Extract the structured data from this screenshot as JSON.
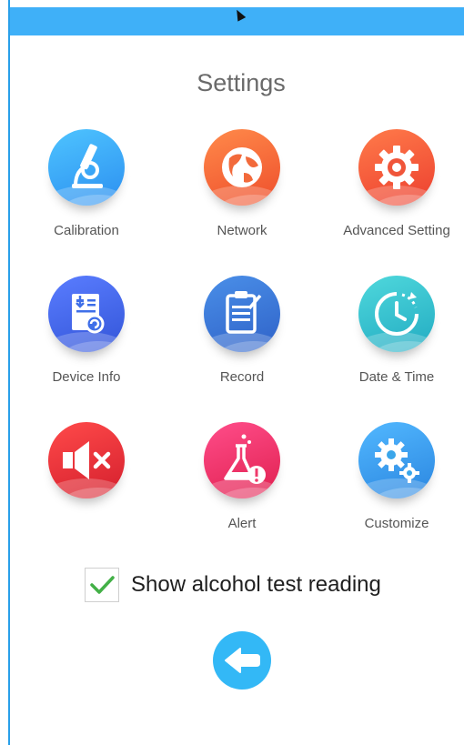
{
  "title": "Settings",
  "colors": {
    "top_bar": "#3fb0f8",
    "checkmark": "#43b047",
    "back_button": "#33b8f6"
  },
  "tiles": [
    {
      "label": "Calibration",
      "icon": "microscope-icon",
      "color": "#3aa9f1"
    },
    {
      "label": "Network",
      "icon": "globe-icon",
      "color": "#f26a3b"
    },
    {
      "label": "Advanced Setting",
      "icon": "gear-icon",
      "color": "#f0553a"
    },
    {
      "label": "Device Info",
      "icon": "device-info-icon",
      "color": "#3f6fe8"
    },
    {
      "label": "Record",
      "icon": "clipboard-icon",
      "color": "#3a78d9"
    },
    {
      "label": "Date & Time",
      "icon": "clock-icon",
      "color": "#35c4cf"
    },
    {
      "label": "",
      "icon": "mute-speaker-icon",
      "color": "#e8303a"
    },
    {
      "label": "Alert",
      "icon": "flask-alert-icon",
      "color": "#ef3a6b"
    },
    {
      "label": "Customize",
      "icon": "gears-icon",
      "color": "#3aa6ea"
    }
  ],
  "checkbox": {
    "label": "Show alcohol test reading",
    "checked": true
  },
  "back_button": {
    "icon": "back-arrow-icon"
  }
}
